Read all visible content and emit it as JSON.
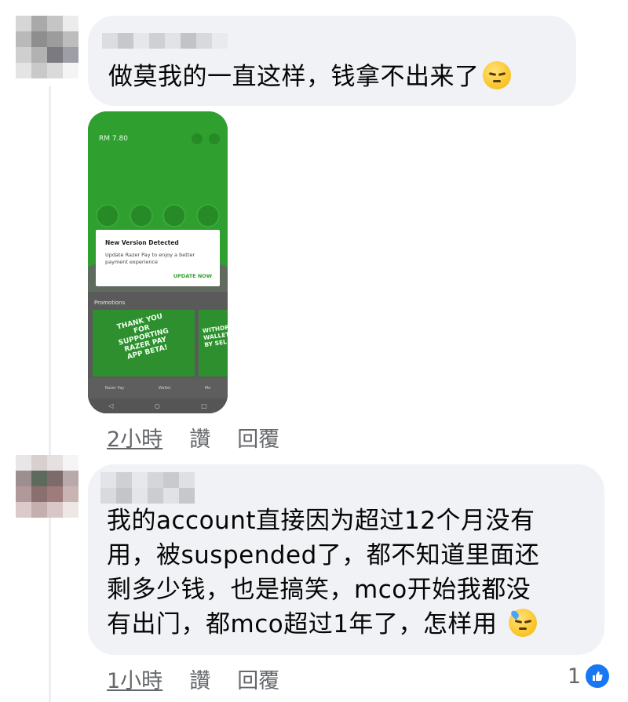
{
  "comments": [
    {
      "text": "做莫我的一直这样，钱拿不出来了",
      "emoji": "pensive-face",
      "attachment": {
        "balance": "RM 7.80",
        "dialog_title": "New Version Detected",
        "dialog_body": "Update Razer Pay to enjoy a better payment experience",
        "dialog_button": "UPDATE NOW",
        "promotions_label": "Promotions",
        "promo1_text": "THANK YOU FOR SUPPORTING RAZER PAY APP BETA!",
        "promo2_text": "WITHDR WALLET BY SEL",
        "nav_items": [
          "Razer Pay",
          "Wallet",
          "Me"
        ]
      },
      "timestamp": "2小時",
      "like_label": "讚",
      "reply_label": "回覆"
    },
    {
      "lines": [
        "我的account直接因为超过12个月没有",
        "用，被suspended了，都不知道里面还",
        "剩多少钱，也是搞笑，mco开始我都没",
        "有出门，都mco超过1年了，怎样用"
      ],
      "emoji": "downcast-face-with-sweat",
      "timestamp": "1小時",
      "like_label": "讚",
      "reply_label": "回覆",
      "reaction_count": "1"
    }
  ],
  "colors": {
    "bubble": "#f0f2f5",
    "meta_text": "#65676b",
    "like_blue": "#1877f2",
    "app_green": "#2fa02f"
  }
}
